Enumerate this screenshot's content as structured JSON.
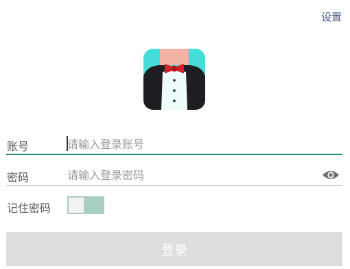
{
  "header": {
    "settings_label": "设置"
  },
  "logo": {
    "icon": "tuxedo-avatar-icon"
  },
  "account": {
    "label": "账号",
    "placeholder": "请输入登录账号",
    "value": ""
  },
  "password": {
    "label": "密码",
    "placeholder": "请输入登录密码",
    "value": "",
    "visibility_icon": "eye-icon"
  },
  "remember": {
    "label": "记住密码",
    "enabled": false
  },
  "login": {
    "label": "登录"
  },
  "colors": {
    "accent": "#1f8a78",
    "toggle_track": "#a9cfc4",
    "button_disabled": "#dddddd",
    "link": "#4a5a8a"
  }
}
